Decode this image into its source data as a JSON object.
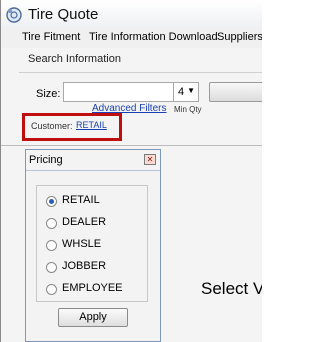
{
  "window": {
    "title": "Tire Quote",
    "icon": "app-icon"
  },
  "menu": [
    {
      "label": "Tire Fitment"
    },
    {
      "label": "Tire Information Download"
    },
    {
      "label": "Suppliers"
    }
  ],
  "search": {
    "group_label": "Search Information",
    "size_label": "Size:",
    "size_value": "",
    "qty_value": "4",
    "advanced_filters": "Advanced Filters",
    "min_qty": "Min Qty"
  },
  "customer": {
    "label": "Customer:",
    "value": "RETAIL"
  },
  "pricing": {
    "title": "Pricing",
    "close_icon": "close-icon",
    "options": [
      {
        "label": "RETAIL",
        "selected": true
      },
      {
        "label": "DEALER",
        "selected": false
      },
      {
        "label": "WHSLE",
        "selected": false
      },
      {
        "label": "JOBBER",
        "selected": false
      },
      {
        "label": "EMPLOYEE",
        "selected": false
      }
    ],
    "apply_label": "Apply"
  },
  "main": {
    "partial_text": "Select V"
  },
  "colors": {
    "highlight": "#c00d0d",
    "link": "#1a3fb5",
    "radio_selected": "#2a5db8"
  }
}
